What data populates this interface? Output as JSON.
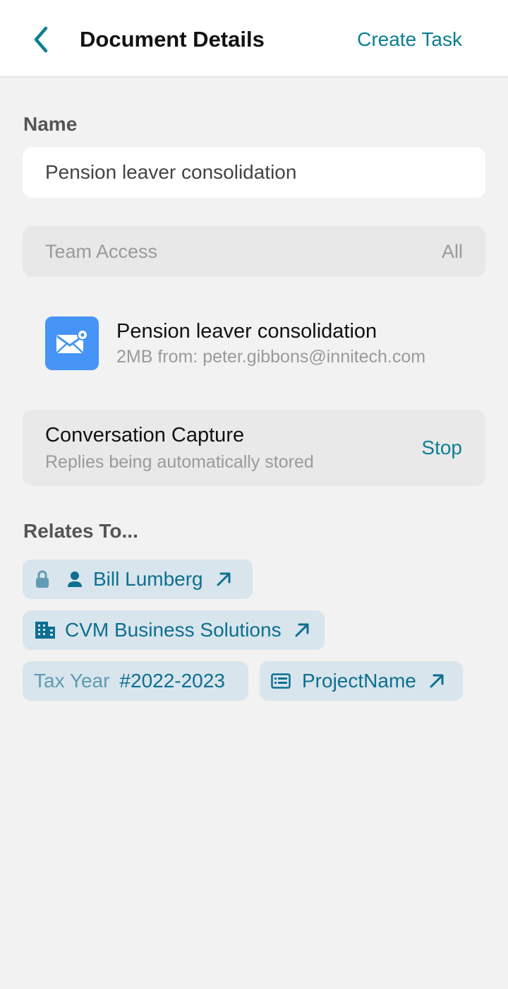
{
  "header": {
    "title": "Document Details",
    "action_label": "Create Task"
  },
  "name_section": {
    "label": "Name",
    "value": "Pension leaver consolidation"
  },
  "team_access": {
    "label": "Team Access",
    "value": "All"
  },
  "document": {
    "title": "Pension leaver consolidation",
    "subtitle": "2MB from: peter.gibbons@innitech.com",
    "icon": "email-attachment-icon"
  },
  "conversation_capture": {
    "title": "Conversation Capture",
    "subtitle": "Replies being automatically stored",
    "action_label": "Stop"
  },
  "relates_to": {
    "label": "Relates To...",
    "chips": [
      {
        "label": "Bill Lumberg",
        "icons": [
          "lock-icon",
          "person-icon"
        ]
      },
      {
        "label": "CVM Business Solutions",
        "icons": [
          "building-icon"
        ]
      },
      {
        "prefix": "Tax Year",
        "label": "#2022-2023"
      },
      {
        "label": "ProjectName",
        "icons": [
          "project-card-icon"
        ]
      }
    ]
  },
  "colors": {
    "accent": "#0b7f93",
    "chip_bg": "#d8e5ec",
    "chip_text": "#0d6f91",
    "doc_icon_bg": "#4694f5"
  }
}
